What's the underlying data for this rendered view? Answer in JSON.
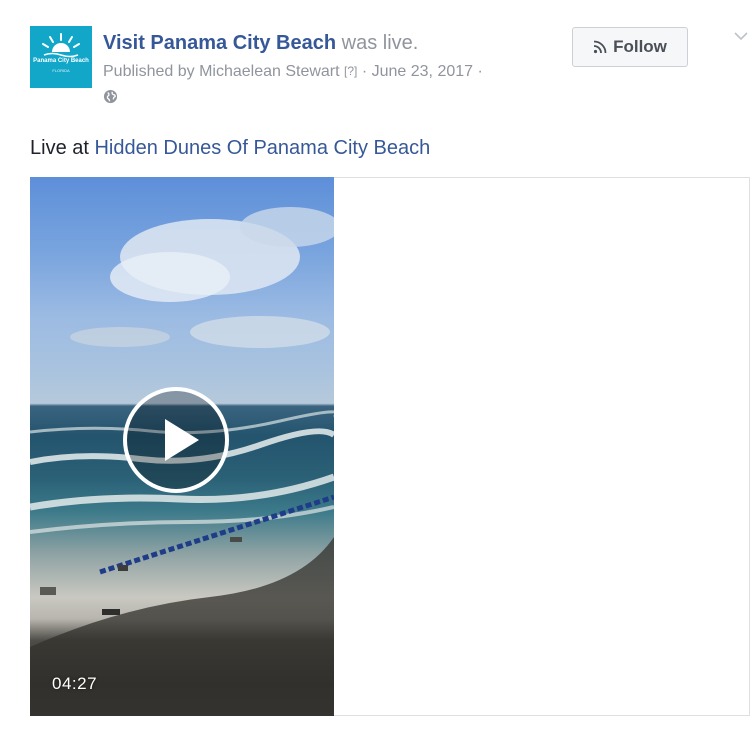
{
  "post": {
    "page_name": "Visit Panama City Beach",
    "was_live": "was live.",
    "published_by_prefix": "Published by ",
    "publisher": "Michaelean Stewart",
    "help_mark": "[?]",
    "date": "June 23, 2017",
    "separator": "·",
    "privacy_icon": "globe-icon",
    "follow_label": "Follow",
    "follow_icon": "rss-icon",
    "menu_icon": "chevron-down-icon",
    "caption_prefix": "Live at ",
    "caption_place": "Hidden Dunes Of Panama City Beach"
  },
  "avatar": {
    "logo_line1": "Panama City Beach",
    "logo_line2": "FLORIDA"
  },
  "video": {
    "duration": "04:27",
    "play_icon": "play-icon"
  },
  "colors": {
    "link_blue": "#365899",
    "meta_gray": "#90949c",
    "avatar_teal": "#12a7c9",
    "button_bg": "#f6f7f9",
    "button_border": "#ced0d4"
  }
}
